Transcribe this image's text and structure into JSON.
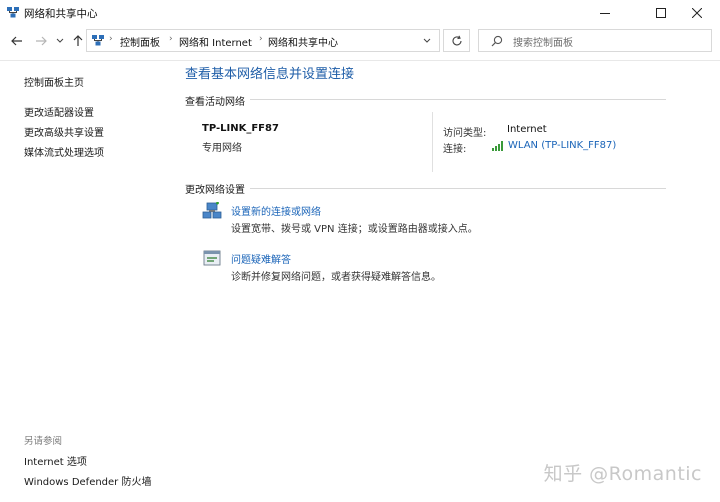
{
  "window": {
    "title": "网络和共享中心",
    "controls": {
      "minimize_icon": "minimize-icon",
      "maximize_icon": "maximize-icon",
      "close_icon": "close-icon"
    }
  },
  "nav": {
    "breadcrumbs": [
      "控制面板",
      "网络和 Internet",
      "网络和共享中心"
    ],
    "search_placeholder": "搜索控制面板"
  },
  "sidebar": {
    "items": [
      {
        "label": "控制面板主页"
      },
      {
        "label": "更改适配器设置"
      },
      {
        "label": "更改高级共享设置"
      },
      {
        "label": "媒体流式处理选项"
      }
    ],
    "see_also_title": "另请参阅",
    "see_also_items": [
      {
        "label": "Internet 选项"
      },
      {
        "label": "Windows Defender 防火墙"
      }
    ]
  },
  "main": {
    "title": "查看基本网络信息并设置连接",
    "active_networks_header": "查看活动网络",
    "network": {
      "name": "TP-LINK_FF87",
      "category": "专用网络",
      "access_type_label": "访问类型:",
      "access_type_value": "Internet",
      "connections_label": "连接:",
      "connection_value": "WLAN (TP-LINK_FF87)"
    },
    "change_settings_header": "更改网络设置",
    "tasks": [
      {
        "title": "设置新的连接或网络",
        "desc": "设置宽带、拨号或 VPN 连接；或设置路由器或接入点。"
      },
      {
        "title": "问题疑难解答",
        "desc": "诊断并修复网络问题，或者获得疑难解答信息。"
      }
    ]
  },
  "watermark": "知乎 @Romantic",
  "colors": {
    "link": "#1a64b8",
    "title": "#1f5ea8",
    "wifi": "#3a9a3a"
  }
}
